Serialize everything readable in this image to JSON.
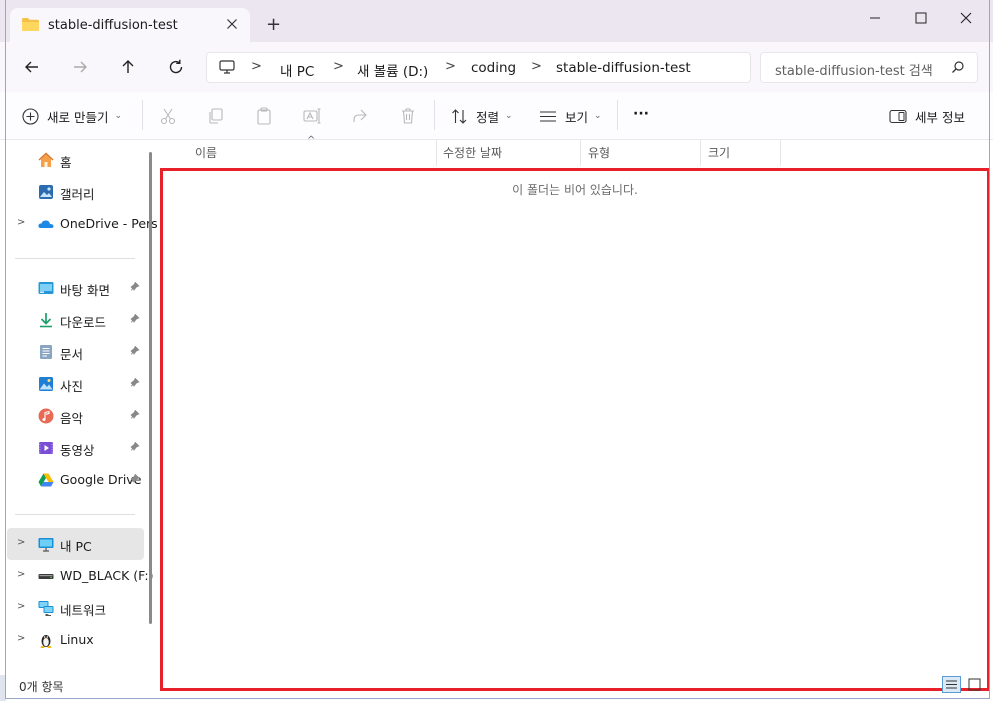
{
  "window": {
    "tab_title": "stable-diffusion-test",
    "new_tab_symbol": "+"
  },
  "address": {
    "crumbs": [
      "내 PC",
      "새 볼륨 (D:)",
      "coding",
      "stable-diffusion-test"
    ],
    "separator": ">"
  },
  "search": {
    "placeholder": "stable-diffusion-test 검색"
  },
  "toolbar": {
    "new_label": "새로 만들기",
    "sort_label": "정렬",
    "view_label": "보기",
    "more_label": "···",
    "details_label": "세부 정보"
  },
  "sidebar": {
    "items": [
      {
        "label": "홈",
        "icon": "home-icon"
      },
      {
        "label": "갤러리",
        "icon": "gallery-icon"
      },
      {
        "label": "OneDrive - Pers",
        "icon": "onedrive-icon"
      },
      {
        "label": "바탕 화면",
        "icon": "desktop-icon"
      },
      {
        "label": "다운로드",
        "icon": "download-icon"
      },
      {
        "label": "문서",
        "icon": "documents-icon"
      },
      {
        "label": "사진",
        "icon": "pictures-icon"
      },
      {
        "label": "음악",
        "icon": "music-icon"
      },
      {
        "label": "동영상",
        "icon": "videos-icon"
      },
      {
        "label": "Google Drive",
        "icon": "google-drive-icon"
      },
      {
        "label": "내 PC",
        "icon": "this-pc-icon"
      },
      {
        "label": "WD_BLACK (F:)",
        "icon": "drive-icon"
      },
      {
        "label": "네트워크",
        "icon": "network-icon"
      },
      {
        "label": "Linux",
        "icon": "linux-icon"
      }
    ]
  },
  "columns": {
    "name": "이름",
    "modified": "수정한 날짜",
    "type": "유형",
    "size": "크기"
  },
  "content": {
    "empty_message": "이 폴더는 비어 있습니다."
  },
  "status": {
    "item_count": "0개 항목"
  },
  "colors": {
    "highlight_border": "#e8202a",
    "titlebar": "#ece6f1",
    "selected_nav": "#e6e6e6"
  }
}
